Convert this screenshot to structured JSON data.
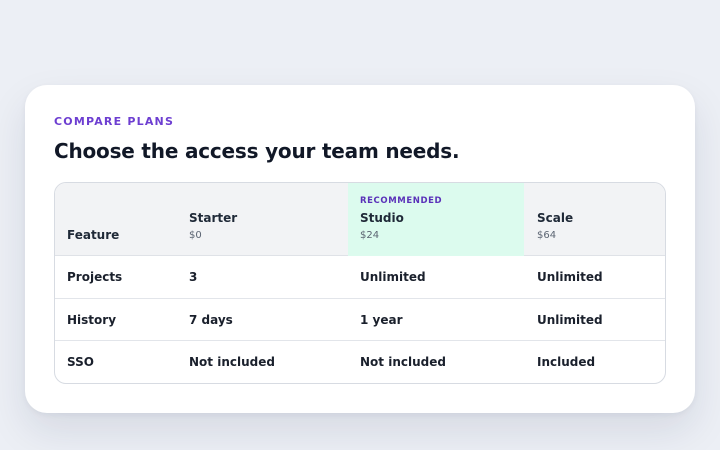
{
  "section": {
    "eyebrow": "COMPARE PLANS",
    "title": "Choose the access your team needs."
  },
  "table": {
    "feature_header": "Feature",
    "plans": [
      {
        "name": "Starter",
        "price": "$0",
        "badge": ""
      },
      {
        "name": "Studio",
        "price": "$24",
        "badge": "RECOMMENDED"
      },
      {
        "name": "Scale",
        "price": "$64",
        "badge": ""
      }
    ],
    "rows": [
      {
        "feature": "Projects",
        "values": [
          "3",
          "Unlimited",
          "Unlimited"
        ]
      },
      {
        "feature": "History",
        "values": [
          "7 days",
          "1 year",
          "Unlimited"
        ]
      },
      {
        "feature": "SSO",
        "values": [
          "Not included",
          "Not included",
          "Included"
        ]
      }
    ]
  },
  "colors": {
    "accent": "#6d3ed1",
    "recommended_bg": "#dcfbee",
    "page_bg": "#eceff5"
  }
}
